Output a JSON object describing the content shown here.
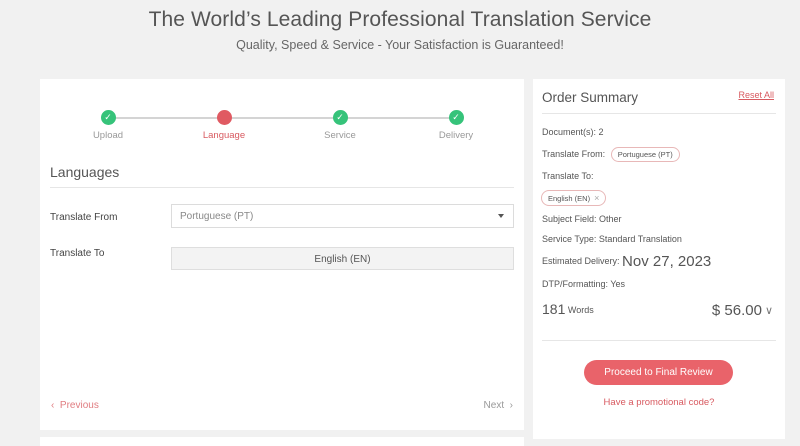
{
  "header": {
    "title": "The World’s Leading Professional Translation Service",
    "subtitle": "Quality, Speed & Service - Your Satisfaction is Guaranteed!"
  },
  "stepper": {
    "steps": [
      {
        "label": "Upload",
        "state": "done"
      },
      {
        "label": "Language",
        "state": "active"
      },
      {
        "label": "Service",
        "state": "done"
      },
      {
        "label": "Delivery",
        "state": "done"
      }
    ]
  },
  "languages": {
    "section_title": "Languages",
    "from_label": "Translate From",
    "from_value": "Portuguese (PT)",
    "to_label": "Translate To",
    "to_value": "English (EN)"
  },
  "nav": {
    "previous": "Previous",
    "next": "Next"
  },
  "order_summary": {
    "title": "Order Summary",
    "reset": "Reset All",
    "documents": "Document(s): 2",
    "translate_from_label": "Translate From:",
    "translate_from_value": "Portuguese (PT)",
    "translate_to_label": "Translate To:",
    "translate_to_value": "English (EN)",
    "subject_field": "Subject Field: Other",
    "service_type": "Service Type:  Standard Translation",
    "delivery_label": "Estimated Delivery:",
    "delivery_date": "Nov 27, 2023",
    "dtp": "DTP/Formatting: Yes",
    "word_count": "181",
    "words_label": "Words",
    "price": "$ 56.00",
    "cta": "Proceed to Final Review",
    "promo": "Have a promotional code?"
  },
  "colors": {
    "accent": "#e9636a",
    "done": "#36c37a",
    "background": "#f1f1f1"
  }
}
